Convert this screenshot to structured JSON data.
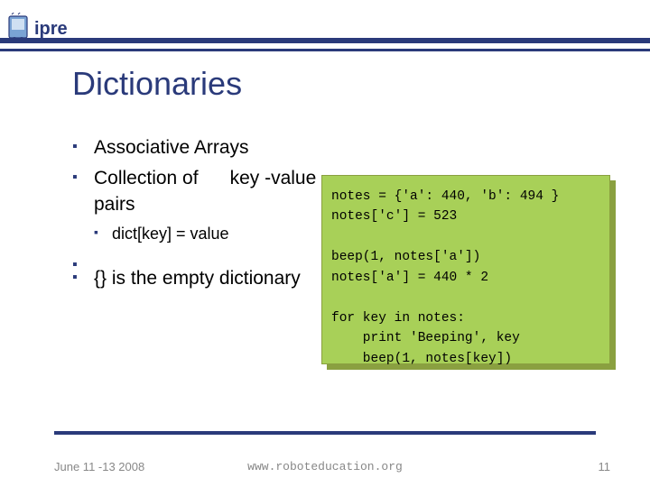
{
  "logo_text": "ipre",
  "title": "Dictionaries",
  "bullets": [
    {
      "text": "Associative Arrays"
    },
    {
      "text": "Collection of      key -value pairs",
      "sub": [
        {
          "text": "dict[key] = value"
        }
      ]
    },
    {
      "text": "{} is the empty dictionary"
    }
  ],
  "code": "notes = {'a': 440, 'b': 494 }\nnotes['c'] = 523\n\nbeep(1, notes['a'])\nnotes['a'] = 440 * 2\n\nfor key in notes:\n    print 'Beeping', key\n    beep(1, notes[key])",
  "footer": {
    "date": "June 11 -13 2008",
    "url": "www.roboteducation.org",
    "page": "11"
  }
}
